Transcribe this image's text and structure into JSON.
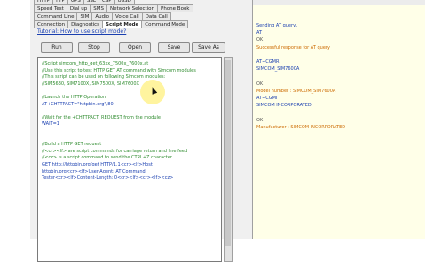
{
  "tabs": {
    "row1": [
      "HTTP",
      "FTP",
      "GPS",
      "SSL",
      "CSP",
      "USSD"
    ],
    "row2": [
      "Speed Test",
      "Dial up",
      "SMS",
      "Network Selection",
      "Phone Book"
    ],
    "row3": [
      "Command Line",
      "SIM",
      "Audio",
      "Voice Call",
      "Data Call"
    ],
    "row4": [
      "Connection",
      "Diagnostics",
      "Script Mode",
      "Command Mode"
    ],
    "active": "Script Mode"
  },
  "tutorial_link": "Tutorial: How to use script mode?",
  "buttons": {
    "run": "Run",
    "stop": "Stop",
    "open": "Open",
    "save": "Save",
    "save_as": "Save As"
  },
  "script_lines": [
    {
      "text": "//Script simcom_http_get_63xx_7500x_7600x.at",
      "kind": "comment"
    },
    {
      "text": "//Use this script to test HTTP GET AT command with Simcom modules",
      "kind": "comment"
    },
    {
      "text": "//This script can be used on following Simcom modules:",
      "kind": "comment"
    },
    {
      "text": "//SIM5630, SIM7100X, SIM7500X, SIM7600X",
      "kind": "comment"
    },
    {
      "text": "",
      "kind": "blank"
    },
    {
      "text": "//Launch the HTTP Operation",
      "kind": "comment"
    },
    {
      "text": "AT+CHTTPACT=\"httpbin.org\",80",
      "kind": "cmd"
    },
    {
      "text": "",
      "kind": "blank"
    },
    {
      "text": "//Wait for the +CHTTPACT: REQUEST from the module",
      "kind": "comment"
    },
    {
      "text": "WAIT=1",
      "kind": "cmd"
    },
    {
      "text": "",
      "kind": "blank"
    },
    {
      "text": "",
      "kind": "blank"
    },
    {
      "text": "//Build a HTTP GET request",
      "kind": "comment"
    },
    {
      "text": "//<cr><lf> are script commands for carriage return and line feed",
      "kind": "comment"
    },
    {
      "text": "//<cz> is a script command to send the CTRL+Z character",
      "kind": "comment"
    },
    {
      "text": "GET http://httpbin.org/get HTTP/1.1<cr><lf>Host",
      "kind": "cmd"
    },
    {
      "text": "httpbin.org<cr><lf>User-Agent: AT Command",
      "kind": "cmd"
    },
    {
      "text": "Tester<cr><lf>Content-Length: 0<cr><lf><cr><lf><cz>",
      "kind": "cmd"
    }
  ],
  "response_lines": [
    {
      "text": "Sending AT query..",
      "kind": "sent"
    },
    {
      "text": "AT",
      "kind": "sent"
    },
    {
      "text": "OK",
      "kind": "ok"
    },
    {
      "text": "Successful response for AT query",
      "kind": "resp"
    },
    {
      "text": "",
      "kind": "blank"
    },
    {
      "text": "AT+CGMR",
      "kind": "sent"
    },
    {
      "text": "SIMCOM_SIM7600A",
      "kind": "sent"
    },
    {
      "text": "",
      "kind": "blank"
    },
    {
      "text": "OK",
      "kind": "ok"
    },
    {
      "text": "Model number : SIMCOM_SIM7600A",
      "kind": "resp"
    },
    {
      "text": "AT+CGMI",
      "kind": "sent"
    },
    {
      "text": "SIMCOM INCORPORATED",
      "kind": "sent"
    },
    {
      "text": "",
      "kind": "blank"
    },
    {
      "text": "OK",
      "kind": "ok"
    },
    {
      "text": "Manufacturer : SIMCOM INCORPORATED",
      "kind": "resp"
    }
  ]
}
